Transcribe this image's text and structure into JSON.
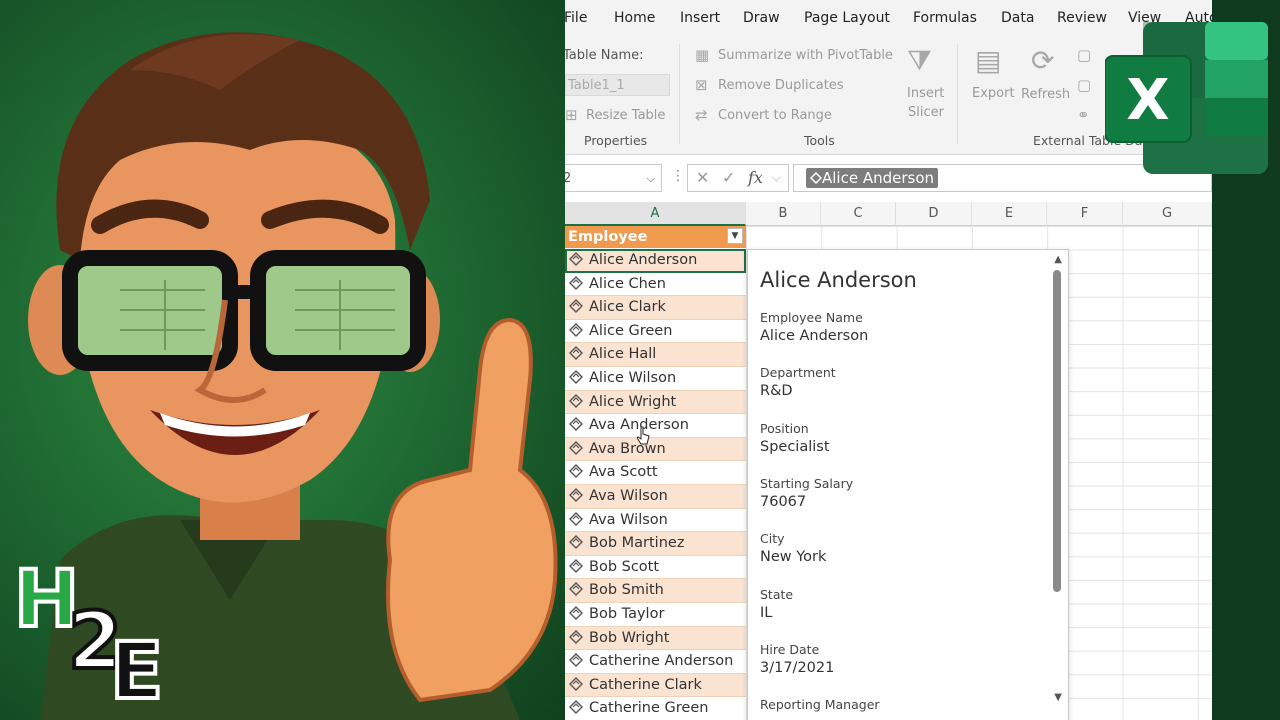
{
  "menu": [
    "File",
    "Home",
    "Insert",
    "Draw",
    "Page Layout",
    "Formulas",
    "Data",
    "Review",
    "View",
    "Auto"
  ],
  "ribbon": {
    "table_name_label": "Table Name:",
    "table_name_value": "Table1_1",
    "resize_table": "Resize Table",
    "properties_group": "Properties",
    "summarize_pivot": "Summarize with PivotTable",
    "remove_duplicates": "Remove Duplicates",
    "convert_to_range": "Convert to Range",
    "tools_group": "Tools",
    "insert_slicer_1": "Insert",
    "insert_slicer_2": "Slicer",
    "export": "Export",
    "refresh": "Refresh",
    "external_group": "External Table Dat"
  },
  "formula_bar": {
    "name_box": "2",
    "cancel_icon": "✕",
    "enter_icon": "✓",
    "fx": "fx",
    "value": "Alice Anderson"
  },
  "columns": [
    "A",
    "B",
    "C",
    "D",
    "E",
    "F",
    "G"
  ],
  "table": {
    "header": "Employee",
    "rows": [
      "Alice Anderson",
      "Alice Chen",
      "Alice Clark",
      "Alice Green",
      "Alice Hall",
      "Alice Wilson",
      "Alice Wright",
      "Ava Anderson",
      "Ava Brown",
      "Ava Scott",
      "Ava Wilson",
      "Ava Wilson",
      "Bob Martinez",
      "Bob Scott",
      "Bob Smith",
      "Bob Taylor",
      "Bob Wright",
      "Catherine Anderson",
      "Catherine Clark",
      "Catherine Green"
    ]
  },
  "card": {
    "title": "Alice Anderson",
    "fields": [
      {
        "label": "Employee Name",
        "value": "Alice Anderson"
      },
      {
        "label": "Department",
        "value": "R&D"
      },
      {
        "label": "Position",
        "value": "Specialist"
      },
      {
        "label": "Starting Salary",
        "value": "76067"
      },
      {
        "label": "City",
        "value": "New York"
      },
      {
        "label": "State",
        "value": "IL"
      },
      {
        "label": "Hire Date",
        "value": "3/17/2021"
      },
      {
        "label": "Reporting Manager",
        "value": ""
      }
    ]
  },
  "logo": {
    "excel_letter": "X",
    "brand": "H2E"
  },
  "colors": {
    "excel_green": "#1e7145",
    "table_orange": "#ef9a4f",
    "band_row": "#fbe3d2",
    "brand_green": "#2aa845"
  }
}
